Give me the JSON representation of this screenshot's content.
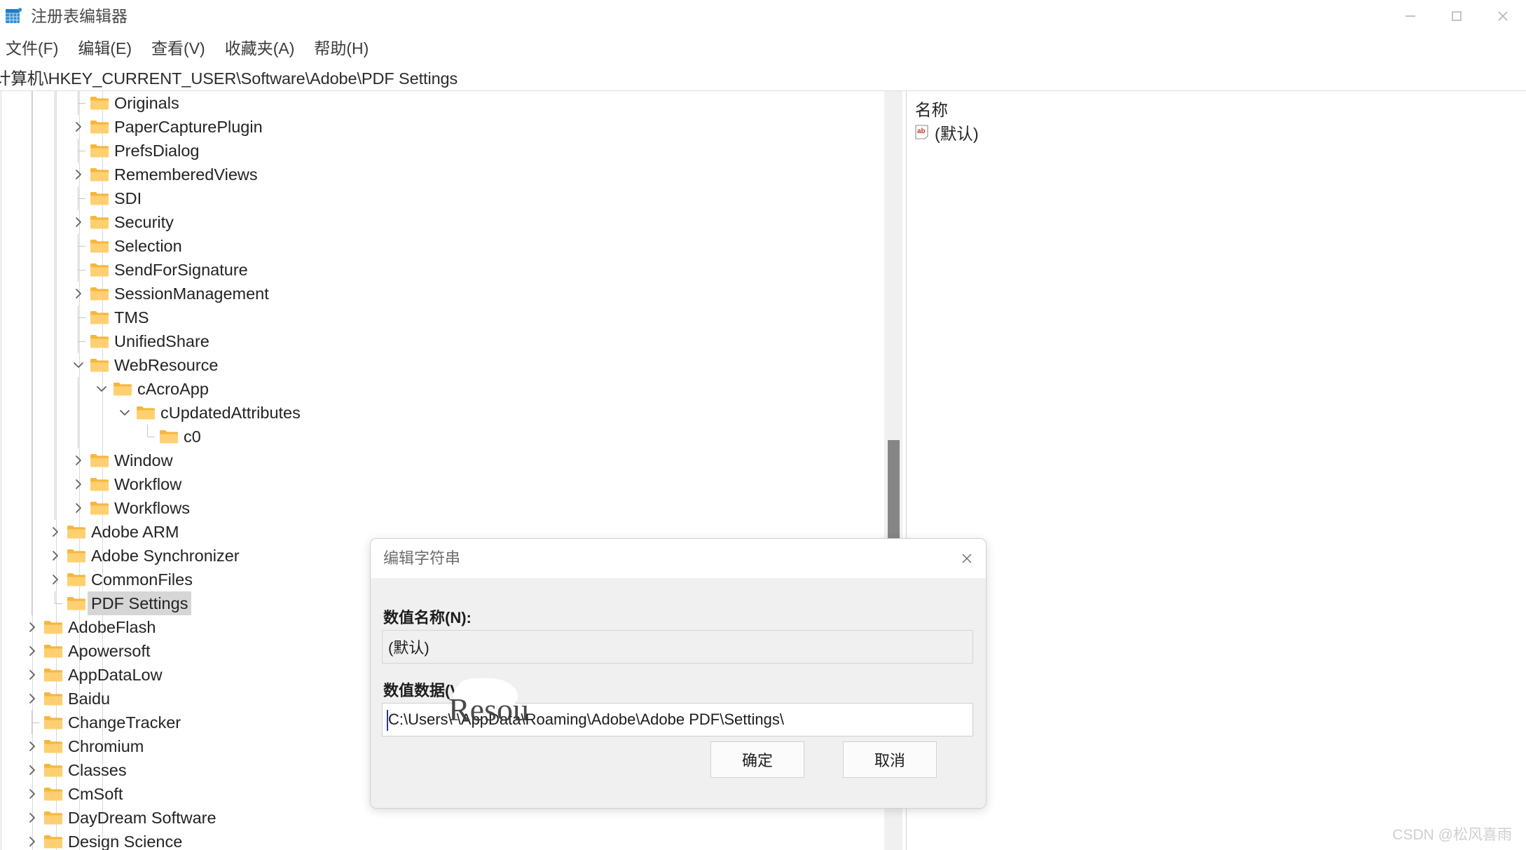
{
  "window": {
    "title": "注册表编辑器",
    "icon": "registry-editor-icon",
    "minimize_label": "—",
    "maximize_label": "□",
    "close_label": "✕"
  },
  "menubar": {
    "items": [
      {
        "label": "文件(F)"
      },
      {
        "label": "编辑(E)"
      },
      {
        "label": "查看(V)"
      },
      {
        "label": "收藏夹(A)"
      },
      {
        "label": "帮助(H)"
      }
    ]
  },
  "addressbar": {
    "path": "计算机\\HKEY_CURRENT_USER\\Software\\Adobe\\PDF Settings"
  },
  "tree": {
    "nodes": [
      {
        "label": "Originals",
        "indent": 4,
        "twisty": "none",
        "selected": false
      },
      {
        "label": "PaperCapturePlugin",
        "indent": 4,
        "twisty": "collapsed",
        "selected": false
      },
      {
        "label": "PrefsDialog",
        "indent": 4,
        "twisty": "none",
        "selected": false
      },
      {
        "label": "RememberedViews",
        "indent": 4,
        "twisty": "collapsed",
        "selected": false
      },
      {
        "label": "SDI",
        "indent": 4,
        "twisty": "none",
        "selected": false
      },
      {
        "label": "Security",
        "indent": 4,
        "twisty": "collapsed",
        "selected": false
      },
      {
        "label": "Selection",
        "indent": 4,
        "twisty": "none",
        "selected": false
      },
      {
        "label": "SendForSignature",
        "indent": 4,
        "twisty": "none",
        "selected": false
      },
      {
        "label": "SessionManagement",
        "indent": 4,
        "twisty": "collapsed",
        "selected": false
      },
      {
        "label": "TMS",
        "indent": 4,
        "twisty": "none",
        "selected": false
      },
      {
        "label": "UnifiedShare",
        "indent": 4,
        "twisty": "none",
        "selected": false
      },
      {
        "label": "WebResource",
        "indent": 4,
        "twisty": "expanded",
        "selected": false
      },
      {
        "label": "cAcroApp",
        "indent": 5,
        "twisty": "expanded",
        "selected": false
      },
      {
        "label": "cUpdatedAttributes",
        "indent": 6,
        "twisty": "expanded",
        "selected": false
      },
      {
        "label": "c0",
        "indent": 7,
        "twisty": "none",
        "selected": false
      },
      {
        "label": "Window",
        "indent": 4,
        "twisty": "collapsed",
        "selected": false
      },
      {
        "label": "Workflow",
        "indent": 4,
        "twisty": "collapsed",
        "selected": false
      },
      {
        "label": "Workflows",
        "indent": 4,
        "twisty": "collapsed",
        "selected": false
      },
      {
        "label": "Adobe ARM",
        "indent": 3,
        "twisty": "collapsed",
        "selected": false
      },
      {
        "label": "Adobe Synchronizer",
        "indent": 3,
        "twisty": "collapsed",
        "selected": false
      },
      {
        "label": "CommonFiles",
        "indent": 3,
        "twisty": "collapsed",
        "selected": false
      },
      {
        "label": "PDF Settings",
        "indent": 3,
        "twisty": "none",
        "selected": true
      },
      {
        "label": "AdobeFlash",
        "indent": 2,
        "twisty": "collapsed",
        "selected": false
      },
      {
        "label": "Apowersoft",
        "indent": 2,
        "twisty": "collapsed",
        "selected": false
      },
      {
        "label": "AppDataLow",
        "indent": 2,
        "twisty": "collapsed",
        "selected": false
      },
      {
        "label": "Baidu",
        "indent": 2,
        "twisty": "collapsed",
        "selected": false
      },
      {
        "label": "ChangeTracker",
        "indent": 2,
        "twisty": "none",
        "selected": false
      },
      {
        "label": "Chromium",
        "indent": 2,
        "twisty": "collapsed",
        "selected": false
      },
      {
        "label": "Classes",
        "indent": 2,
        "twisty": "collapsed",
        "selected": false
      },
      {
        "label": "CmSoft",
        "indent": 2,
        "twisty": "collapsed",
        "selected": false
      },
      {
        "label": "DayDream Software",
        "indent": 2,
        "twisty": "collapsed",
        "selected": false
      },
      {
        "label": "Design Science",
        "indent": 2,
        "twisty": "collapsed",
        "selected": false
      }
    ]
  },
  "values_pane": {
    "column_header": "名称",
    "rows": [
      {
        "icon": "string-value-icon",
        "name": "(默认)"
      }
    ]
  },
  "dialog": {
    "title": "编辑字符串",
    "close_label": "✕",
    "name_label": "数值名称(N):",
    "name_value": "(默认)",
    "data_label": "数值数据(V):",
    "data_value": "C:\\Users\\        \\AppData\\Roaming\\Adobe\\Adobe PDF\\Settings\\",
    "ok_label": "确定",
    "cancel_label": "取消"
  },
  "overlay": {
    "scribble_text": "Resou"
  },
  "watermark": {
    "text": "CSDN @松风喜雨"
  },
  "colors": {
    "folder": "#ffc84d",
    "folder_dark": "#f0a500",
    "selection": "#d6d6d6",
    "accent": "#0078d7",
    "string_icon_red": "#c0392b",
    "scrollbar_thumb": "#868686"
  }
}
